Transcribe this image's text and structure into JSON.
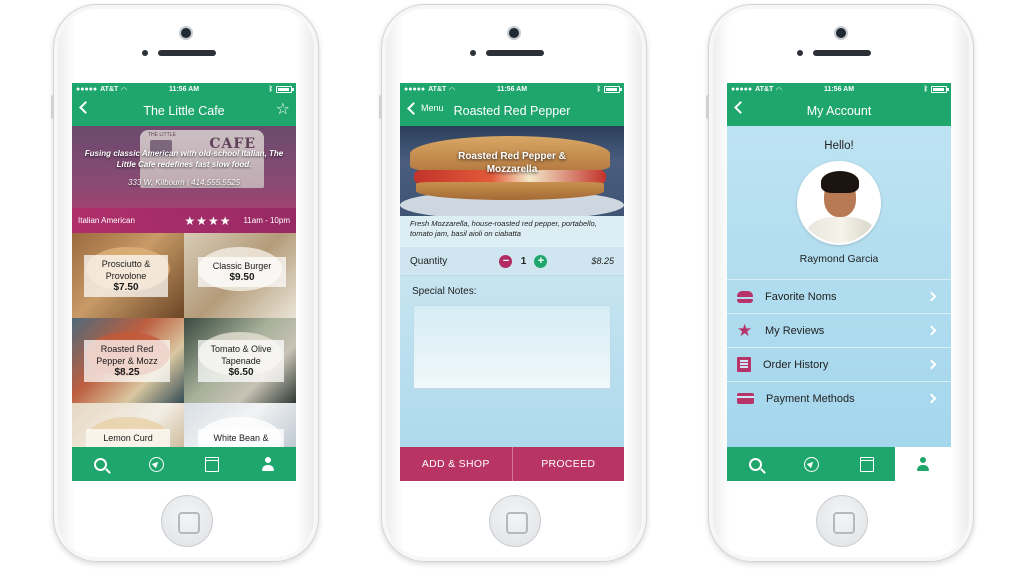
{
  "status": {
    "carrier": "AT&T",
    "time": "11:56 AM"
  },
  "screen1": {
    "title": "The Little Cafe",
    "hero": {
      "truck_sign": "CAFE",
      "truck_small": "THE LITTLE",
      "tagline": "Fusing classic American with old-school Italian, The Little Cafe redefines fast slow food.",
      "address": "333 W. Kilbourn | 414.555.5525",
      "cuisine": "Italian American",
      "stars": "★★★★",
      "rating": 4,
      "hours": "11am - 10pm"
    },
    "menu": [
      {
        "name": "Prosciutto & Provolone",
        "price": "$7.50"
      },
      {
        "name": "Classic Burger",
        "price": "$9.50"
      },
      {
        "name": "Roasted Red Pepper & Mozz",
        "price": "$8.25"
      },
      {
        "name": "Tomato & Olive Tapenade",
        "price": "$6.50"
      },
      {
        "name": "Lemon Curd",
        "price": ""
      },
      {
        "name": "White Bean &",
        "price": ""
      }
    ]
  },
  "screen2": {
    "back_label": "Menu",
    "title": "Roasted Red Pepper",
    "hero_caption": "Roasted Red Pepper & Mozzarella",
    "description": "Fresh Mozzarella, house-roasted red pepper, portabello, tomato jam, basil aioli on ciabatta",
    "quantity_label": "Quantity",
    "quantity": "1",
    "price": "$8.25",
    "notes_label": "Special Notes:",
    "notes_value": "",
    "add_shop_label": "ADD & SHOP",
    "proceed_label": "PROCEED"
  },
  "screen3": {
    "title": "My Account",
    "greeting": "Hello!",
    "user_name": "Raymond Garcia",
    "menu": [
      {
        "label": "Favorite Noms",
        "icon": "burger-icon"
      },
      {
        "label": "My Reviews",
        "icon": "star-icon"
      },
      {
        "label": "Order History",
        "icon": "list-icon"
      },
      {
        "label": "Payment Methods",
        "icon": "credit-card-icon"
      }
    ]
  },
  "colors": {
    "green": "#1fa66d",
    "magenta": "#b83462",
    "light_blue": "#a9d8ec"
  },
  "tab_icons": [
    "search-icon",
    "navigation-icon",
    "menu-icon",
    "user-icon"
  ]
}
